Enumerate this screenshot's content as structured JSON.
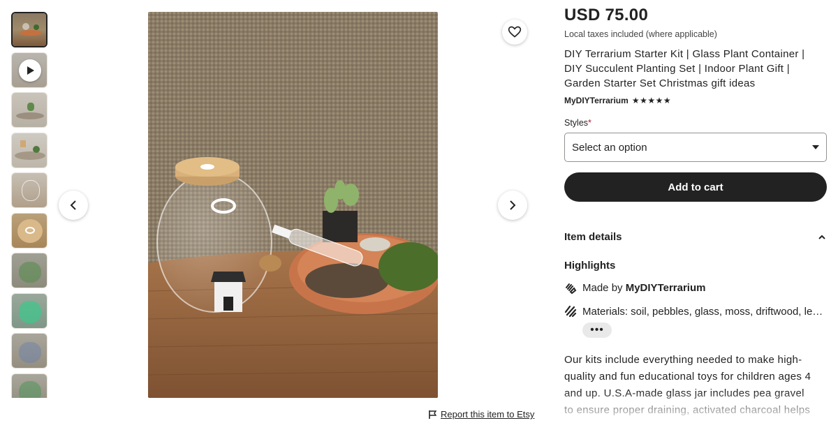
{
  "price": "USD 75.00",
  "tax_note": "Local taxes included (where applicable)",
  "title": "DIY Terrarium Starter Kit | Glass Plant Container | DIY Succulent Planting Set | Indoor Plant Gift | Garden Starter Set Christmas gift ideas",
  "shop_name": "MyDIYTerrarium",
  "rating_stars": "★★★★★",
  "rating_value": 5,
  "styles": {
    "label": "Styles",
    "required_mark": "*",
    "selected": "Select an option"
  },
  "add_to_cart": "Add to cart",
  "item_details": "Item details",
  "highlights": {
    "heading": "Highlights",
    "made_by_prefix": "Made by",
    "made_by_shop": "MyDIYTerrarium",
    "materials": "Materials: soil, pebbles, glass, moss, driftwood, le…",
    "more": "•••"
  },
  "description": "Our kits include everything needed to make high-quality and fun educational toys for children ages 4 and up. U.S.A-made glass jar includes pea gravel to ensure proper draining, activated charcoal helps to",
  "report_link": "Report this item to Etsy",
  "icons": {
    "favorite": "heart-icon",
    "prev": "chevron-left-icon",
    "next": "chevron-right-icon",
    "play": "play-icon",
    "flag": "flag-icon",
    "hand": "hand-icon",
    "materials": "materials-icon",
    "collapse": "chevron-up-icon"
  },
  "colors": {
    "primary_button": "#222222",
    "required": "#a61a2e"
  }
}
